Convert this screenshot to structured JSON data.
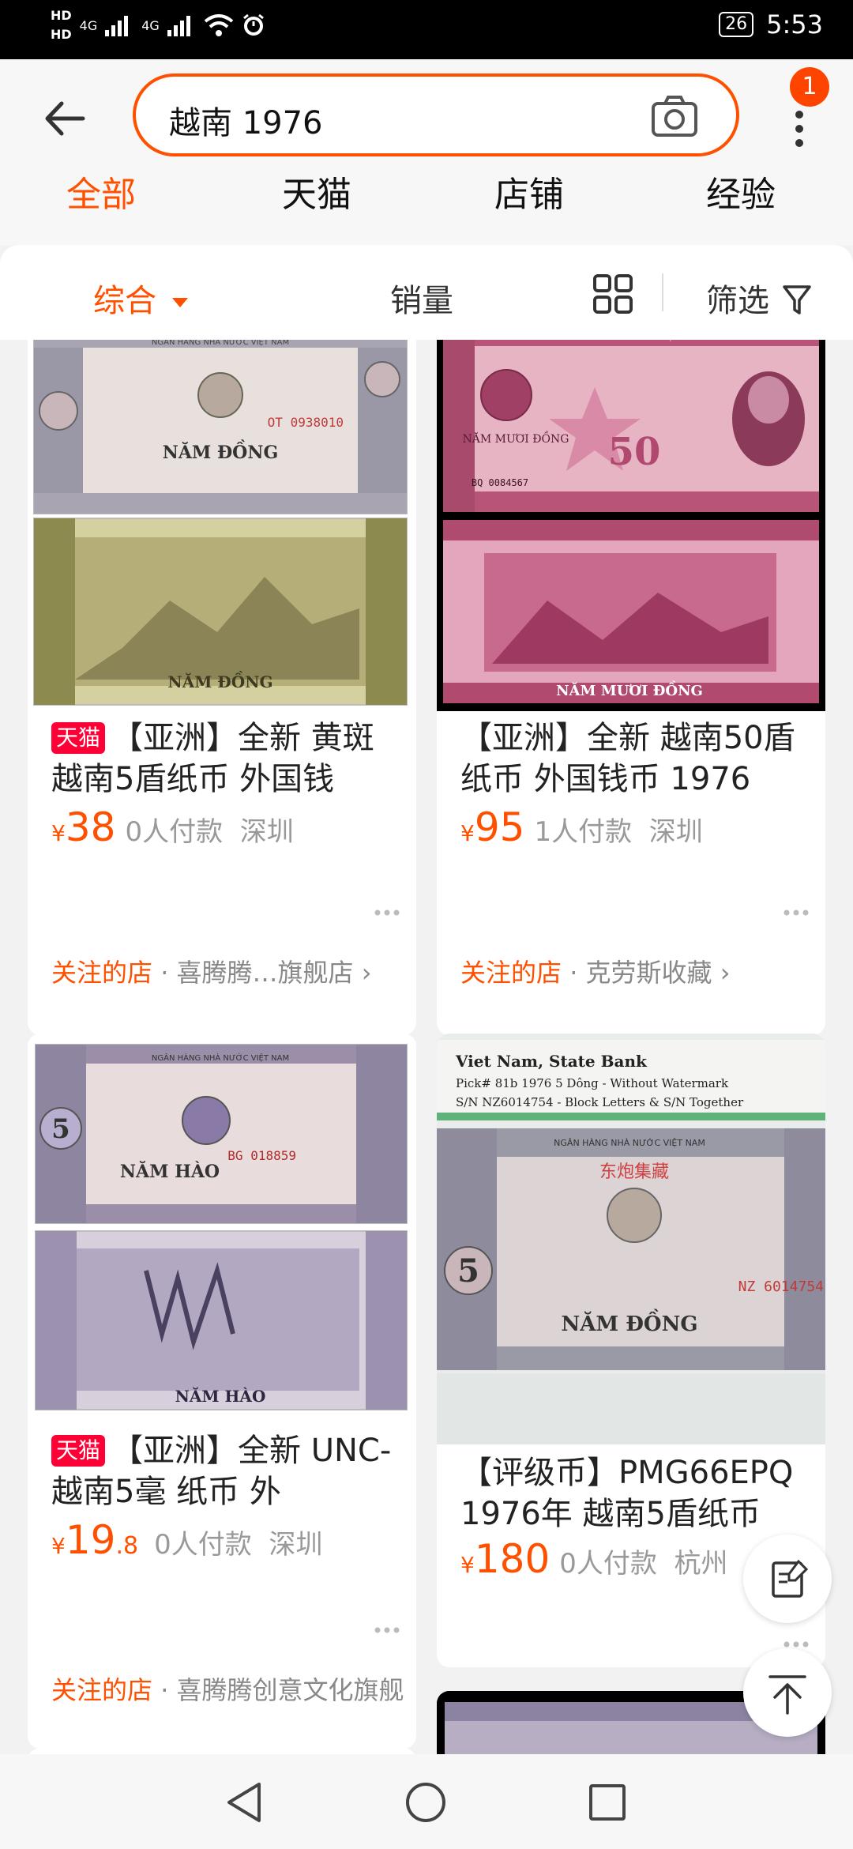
{
  "status_bar": {
    "hd1": "HD",
    "hd2": "HD",
    "signal1": "4G",
    "signal2": "4G",
    "battery": "26",
    "time": "5:53"
  },
  "search": {
    "query": "越南 1976",
    "notification_count": "1"
  },
  "tabs": [
    "全部",
    "天猫",
    "店铺",
    "经验"
  ],
  "filter": {
    "sort": "综合",
    "sales": "销量",
    "screen": "筛选"
  },
  "products": [
    {
      "tmall": "天猫",
      "title": "【亚洲】全新 黄斑 越南5盾纸币 外国钱",
      "currency": "¥",
      "price": "38",
      "price_decimal": "",
      "buyers": "0人付款",
      "location": "深圳",
      "follow": "关注的店",
      "shop": "喜腾腾…旗舰店 ›"
    },
    {
      "tmall": "",
      "title": "【亚洲】全新 越南50盾 纸币 外国钱币 1976",
      "currency": "¥",
      "price": "95",
      "price_decimal": "",
      "buyers": "1人付款",
      "location": "深圳",
      "follow": "关注的店",
      "shop": "克劳斯收藏 ›"
    },
    {
      "tmall": "天猫",
      "title": "【亚洲】全新 UNC- 越南5毫 纸币 外",
      "currency": "¥",
      "price": "19",
      "price_decimal": ".8",
      "buyers": "0人付款",
      "location": "深圳",
      "follow": "关注的店",
      "shop": "喜腾腾创意文化旗舰"
    },
    {
      "tmall": "",
      "title": "【评级币】PMG66EPQ 1976年 越南5盾纸币",
      "currency": "¥",
      "price": "180",
      "price_decimal": "",
      "buyers": "0人付款",
      "location": "杭州",
      "follow": "",
      "shop": ""
    }
  ],
  "banknote_text": {
    "bank": "NGÂN HÀNG NHÀ NƯỚC VIỆT NAM",
    "nam_dong": "NĂM ĐỒNG",
    "serial_1": "OT 0938010",
    "nam_muoi": "NĂM MƯƠI ĐỒNG",
    "serial_2": "BQ 0084567",
    "nam_hao": "NĂM HÀO",
    "serial_3": "BG 018859",
    "pmg_line1": "Viet Nam, State Bank",
    "pmg_line2": "Pick# 81b  1976  5 Dông - Without Watermark",
    "pmg_line3": "S/N NZ6014754 - Block Letters & S/N Together",
    "serial_4": "NZ 6014754",
    "chinese_stamp": "东炮集藏"
  },
  "colors": {
    "accent": "#ff5000",
    "tmall": "#ff0036"
  }
}
